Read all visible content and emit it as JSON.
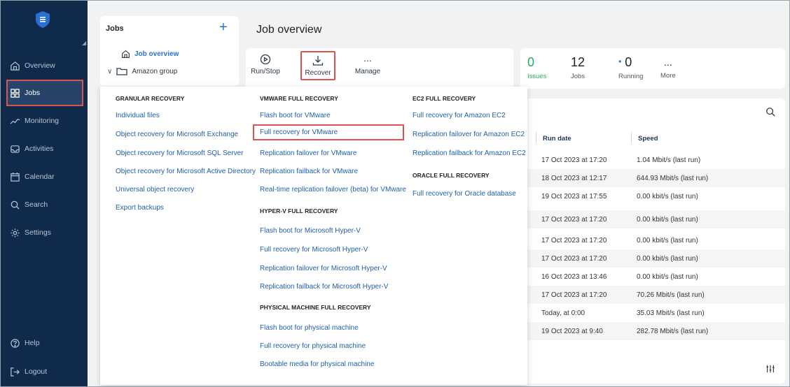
{
  "nav": {
    "items": [
      {
        "label": "Overview",
        "icon": "home-icon"
      },
      {
        "label": "Jobs",
        "icon": "grid-icon"
      },
      {
        "label": "Monitoring",
        "icon": "pulse-icon"
      },
      {
        "label": "Activities",
        "icon": "inbox-icon"
      },
      {
        "label": "Calendar",
        "icon": "calendar-icon"
      },
      {
        "label": "Search",
        "icon": "search-icon"
      },
      {
        "label": "Settings",
        "icon": "gear-icon"
      }
    ],
    "help": "Help",
    "logout": "Logout"
  },
  "jobs_panel": {
    "title": "Jobs",
    "plus": "+",
    "overview": "Job overview",
    "group": "Amazon group"
  },
  "page_title": "Job overview",
  "toolbar": {
    "run_stop": "Run/Stop",
    "recover": "Recover",
    "manage": "Manage",
    "more_dots": "..."
  },
  "stats": {
    "issues": {
      "value": "0",
      "label": "Issues"
    },
    "jobs": {
      "value": "12",
      "label": "Jobs"
    },
    "running": {
      "value": "0",
      "label": "Running"
    },
    "more": {
      "value": "...",
      "label": "More"
    }
  },
  "table": {
    "headers": {
      "run_date": "Run date",
      "speed": "Speed"
    },
    "rows": [
      {
        "date": "17 Oct 2023 at 17:20",
        "speed": "1.04 Mbit/s (last run)"
      },
      {
        "date": "18 Oct 2023 at 12:17",
        "speed": "644.93 Mbit/s (last run)"
      },
      {
        "date": "19 Oct 2023 at 17:55",
        "speed": "0.00 kbit/s (last run)"
      },
      {
        "date": "17 Oct 2023 at 17:20",
        "speed": "0.00 kbit/s (last run)"
      },
      {
        "date": "17 Oct 2023 at 17:20",
        "speed": "0.00 kbit/s (last run)"
      },
      {
        "date": "17 Oct 2023 at 17:20",
        "speed": "0.00 kbit/s (last run)"
      },
      {
        "date": "16 Oct 2023 at 13:46",
        "speed": "0.00 kbit/s (last run)"
      },
      {
        "date": "17 Oct 2023 at 17:20",
        "speed": "70.26 Mbit/s (last run)"
      },
      {
        "date": "Today, at 0:00",
        "speed": "35.03 Mbit/s (last run)"
      },
      {
        "date": "19 Oct 2023 at 9:40",
        "speed": "282.78 Mbit/s (last run)"
      }
    ]
  },
  "menu": {
    "granular": {
      "heading": "GRANULAR RECOVERY",
      "items": [
        "Individual files",
        "Object recovery for Microsoft Exchange",
        "Object recovery for Microsoft SQL Server",
        "Object recovery for Microsoft Active Directory",
        "Universal object recovery",
        "Export backups"
      ]
    },
    "vmware": {
      "heading": "VMWARE FULL RECOVERY",
      "items": [
        "Flash boot for VMware",
        "Full recovery for VMware",
        "Replication failover for VMware",
        "Replication failback for VMware",
        "Real-time replication failover (beta) for VMware"
      ]
    },
    "hyperv": {
      "heading": "HYPER-V FULL RECOVERY",
      "items": [
        "Flash boot for Microsoft Hyper-V",
        "Full recovery for Microsoft Hyper-V",
        "Replication failover for Microsoft Hyper-V",
        "Replication failback for Microsoft Hyper-V"
      ]
    },
    "physical": {
      "heading": "PHYSICAL MACHINE FULL RECOVERY",
      "items": [
        "Flash boot for physical machine",
        "Full recovery for physical machine",
        "Bootable media for physical machine"
      ]
    },
    "ec2": {
      "heading": "EC2 FULL RECOVERY",
      "items": [
        "Full recovery for Amazon EC2",
        "Replication failover for Amazon EC2",
        "Replication failback for Amazon EC2"
      ]
    },
    "oracle": {
      "heading": "ORACLE FULL RECOVERY",
      "items": [
        "Full recovery for Oracle database"
      ]
    }
  },
  "colors": {
    "nav_bg": "#102a4c",
    "accent": "#2970d6",
    "highlight": "#d9534f",
    "issues_green": "#27ae60"
  }
}
